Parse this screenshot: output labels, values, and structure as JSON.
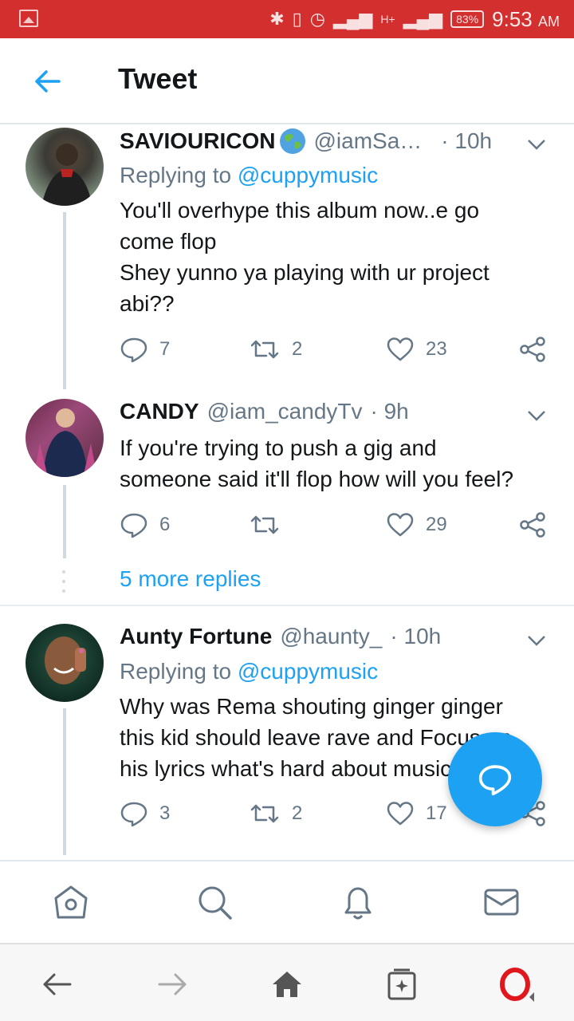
{
  "status_bar": {
    "battery": "83%",
    "time": "9:53",
    "ampm": "AM",
    "network": "H+"
  },
  "header": {
    "title": "Tweet"
  },
  "tweets": [
    {
      "name": "SAVIOURICON",
      "handle": "@iamSa…",
      "time": "· 10h",
      "replying_label": "Replying to",
      "replying_handle": "@cuppymusic",
      "lines": [
        "You'll overhype this album now..e go",
        "come flop",
        "Shey yunno ya playing with ur project",
        "abi??"
      ],
      "replies": "7",
      "retweets": "2",
      "likes": "23"
    },
    {
      "name": "CANDY",
      "handle": "@iam_candyTv",
      "time": "· 9h",
      "lines": [
        "If you're trying to push a gig and",
        "someone said it'll flop how will you feel?"
      ],
      "replies": "6",
      "retweets": "",
      "likes": "29"
    },
    {
      "name": "Aunty Fortune",
      "handle": "@haunty_",
      "time": "· 10h",
      "replying_label": "Replying to",
      "replying_handle": "@cuppymusic",
      "lines": [
        "Why was Rema shouting ginger ginger",
        "this kid should leave rave and Focus on",
        "his lyrics what's hard about music"
      ],
      "replies": "3",
      "retweets": "2",
      "likes": "17"
    }
  ],
  "more_replies": "5 more replies",
  "colors": {
    "accent": "#1da1f2",
    "status_bar": "#d32f2f",
    "muted": "#657786"
  },
  "icons": {
    "tabs": [
      "home-icon",
      "search-icon",
      "bell-icon",
      "mail-icon"
    ],
    "browser": [
      "back-arrow-icon",
      "forward-arrow-icon",
      "home-icon",
      "tabs-icon",
      "opera-icon"
    ]
  }
}
